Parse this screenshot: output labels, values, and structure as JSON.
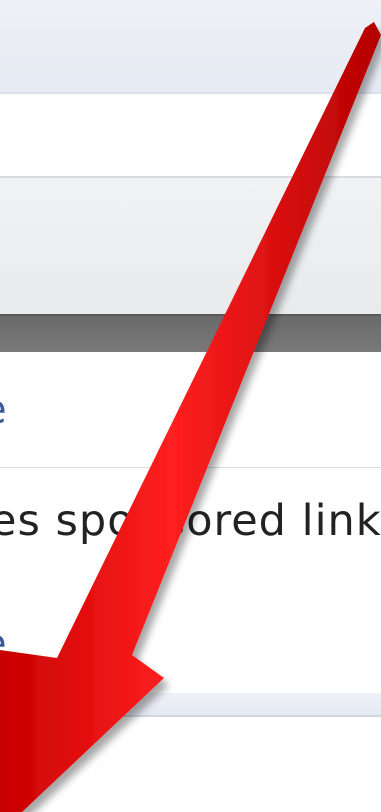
{
  "links": {
    "first_fragment": "e",
    "second_fragment": "e"
  },
  "content": {
    "sponsored_text": "es sponsored link"
  },
  "colors": {
    "link": "#3b5998",
    "arrow": "#e00000",
    "dark_bar": "#6f6f6f"
  },
  "icons": {
    "arrow": "red-annotation-arrow-icon"
  }
}
